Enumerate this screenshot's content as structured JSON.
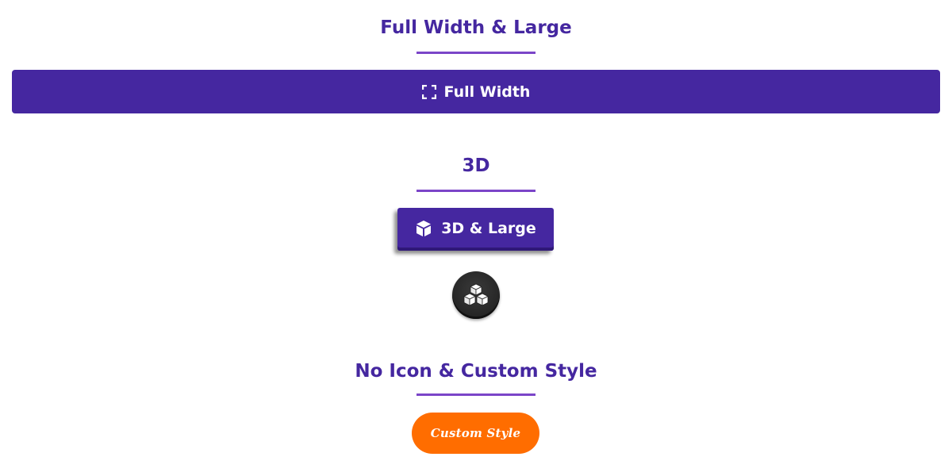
{
  "sections": [
    {
      "title": "Full Width & Large",
      "buttons": [
        {
          "label": "Full Width",
          "icon": "expand-icon"
        }
      ]
    },
    {
      "title": "3D",
      "buttons": [
        {
          "label": "3D & Large",
          "icon": "cube-icon"
        },
        {
          "label": "",
          "icon": "cubes-icon"
        }
      ]
    },
    {
      "title": "No Icon & Custom Style",
      "buttons": [
        {
          "label": "Custom Style",
          "icon": ""
        }
      ]
    }
  ],
  "colors": {
    "title": "#4527a0",
    "divider": "#7b45c8",
    "primary_button": "#4527a0",
    "dark_button": "#252525",
    "custom_button": "#ff6d00",
    "button_text": "#ffffff"
  }
}
